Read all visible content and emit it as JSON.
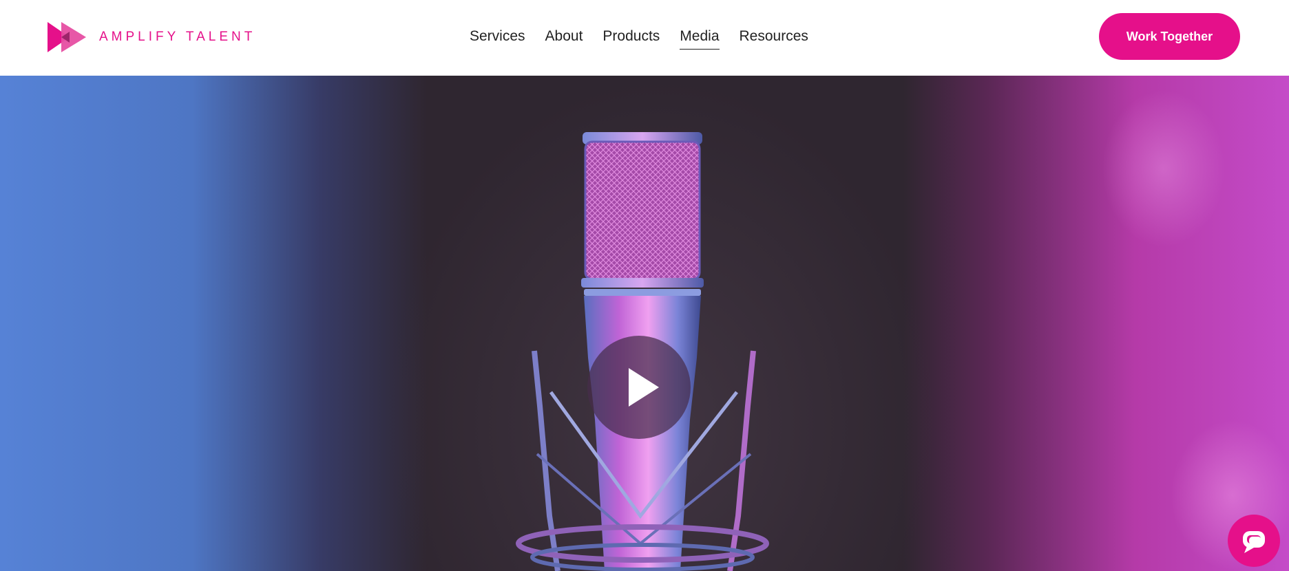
{
  "brand": {
    "name": "AMPLIFY TALENT",
    "accent_color": "#e5108a",
    "logo_icon": "fast-forward-triangles-icon"
  },
  "nav": {
    "items": [
      {
        "label": "Services",
        "active": false
      },
      {
        "label": "About",
        "active": false
      },
      {
        "label": "Products",
        "active": false
      },
      {
        "label": "Media",
        "active": true
      },
      {
        "label": "Resources",
        "active": false
      }
    ]
  },
  "cta": {
    "label": "Work Together",
    "color": "#e5108a"
  },
  "hero": {
    "media": "microphone-video",
    "play_icon": "play-icon",
    "left_tint": "#5682d6",
    "right_tint": "#c44bc8"
  },
  "chat": {
    "icon": "chat-bubble-icon"
  }
}
